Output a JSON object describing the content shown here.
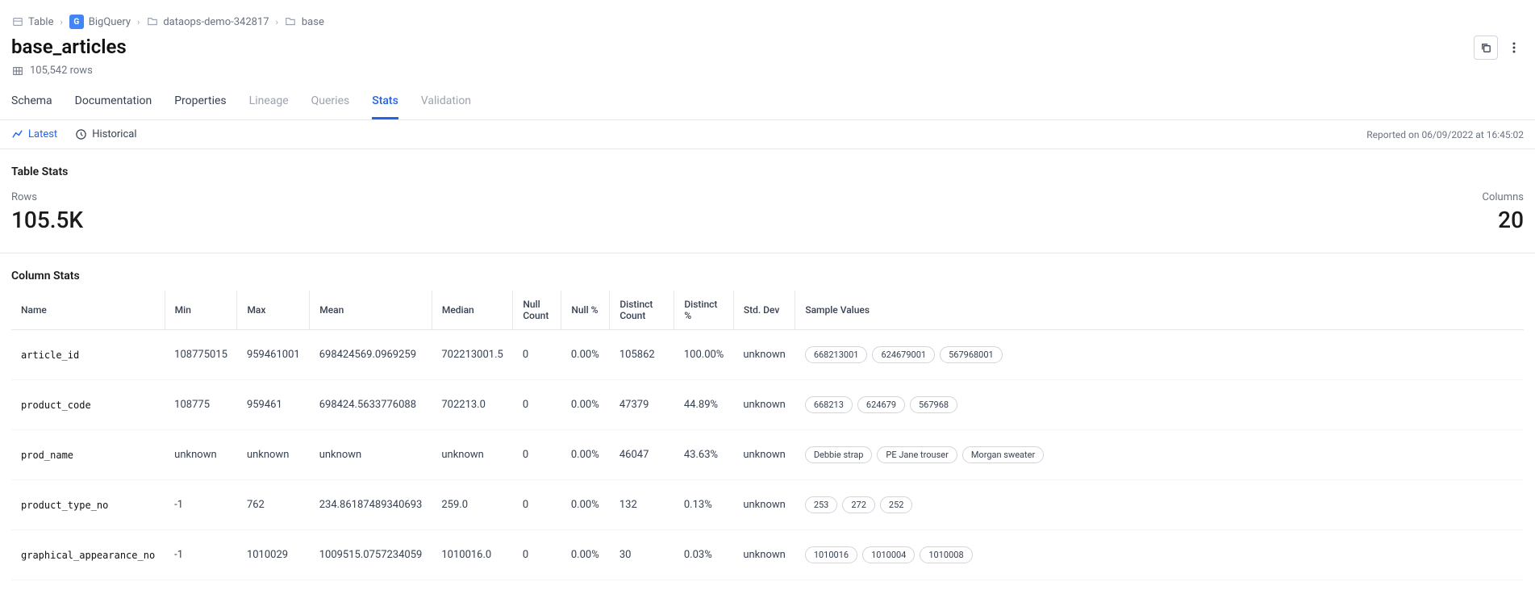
{
  "breadcrumb": {
    "table": "Table",
    "bigquery": "BigQuery",
    "project": "dataops-demo-342817",
    "dataset": "base"
  },
  "page": {
    "title": "base_articles",
    "row_count": "105,542 rows"
  },
  "tabs": {
    "schema": "Schema",
    "documentation": "Documentation",
    "properties": "Properties",
    "lineage": "Lineage",
    "queries": "Queries",
    "stats": "Stats",
    "validation": "Validation"
  },
  "subtabs": {
    "latest": "Latest",
    "historical": "Historical",
    "reported": "Reported on 06/09/2022 at 16:45:02"
  },
  "table_stats": {
    "title": "Table Stats",
    "rows_label": "Rows",
    "rows_value": "105.5K",
    "cols_label": "Columns",
    "cols_value": "20"
  },
  "column_stats": {
    "title": "Column Stats",
    "headers": {
      "name": "Name",
      "min": "Min",
      "max": "Max",
      "mean": "Mean",
      "median": "Median",
      "null_count": "Null Count",
      "null_pct": "Null %",
      "distinct_count": "Distinct Count",
      "distinct_pct": "Distinct %",
      "std_dev": "Std. Dev",
      "sample": "Sample Values"
    },
    "rows": [
      {
        "name": "article_id",
        "min": "108775015",
        "max": "959461001",
        "mean": "698424569.0969259",
        "median": "702213001.5",
        "null_count": "0",
        "null_pct": "0.00%",
        "distinct_count": "105862",
        "distinct_pct": "100.00%",
        "std_dev": "unknown",
        "samples": [
          "668213001",
          "624679001",
          "567968001"
        ]
      },
      {
        "name": "product_code",
        "min": "108775",
        "max": "959461",
        "mean": "698424.5633776088",
        "median": "702213.0",
        "null_count": "0",
        "null_pct": "0.00%",
        "distinct_count": "47379",
        "distinct_pct": "44.89%",
        "std_dev": "unknown",
        "samples": [
          "668213",
          "624679",
          "567968"
        ]
      },
      {
        "name": "prod_name",
        "min": "unknown",
        "max": "unknown",
        "mean": "unknown",
        "median": "unknown",
        "null_count": "0",
        "null_pct": "0.00%",
        "distinct_count": "46047",
        "distinct_pct": "43.63%",
        "std_dev": "unknown",
        "samples": [
          "Debbie strap",
          "PE Jane trouser",
          "Morgan sweater"
        ]
      },
      {
        "name": "product_type_no",
        "min": "-1",
        "max": "762",
        "mean": "234.86187489340693",
        "median": "259.0",
        "null_count": "0",
        "null_pct": "0.00%",
        "distinct_count": "132",
        "distinct_pct": "0.13%",
        "std_dev": "unknown",
        "samples": [
          "253",
          "272",
          "252"
        ]
      },
      {
        "name": "graphical_appearance_no",
        "min": "-1",
        "max": "1010029",
        "mean": "1009515.0757234059",
        "median": "1010016.0",
        "null_count": "0",
        "null_pct": "0.00%",
        "distinct_count": "30",
        "distinct_pct": "0.03%",
        "std_dev": "unknown",
        "samples": [
          "1010016",
          "1010004",
          "1010008"
        ]
      }
    ]
  }
}
